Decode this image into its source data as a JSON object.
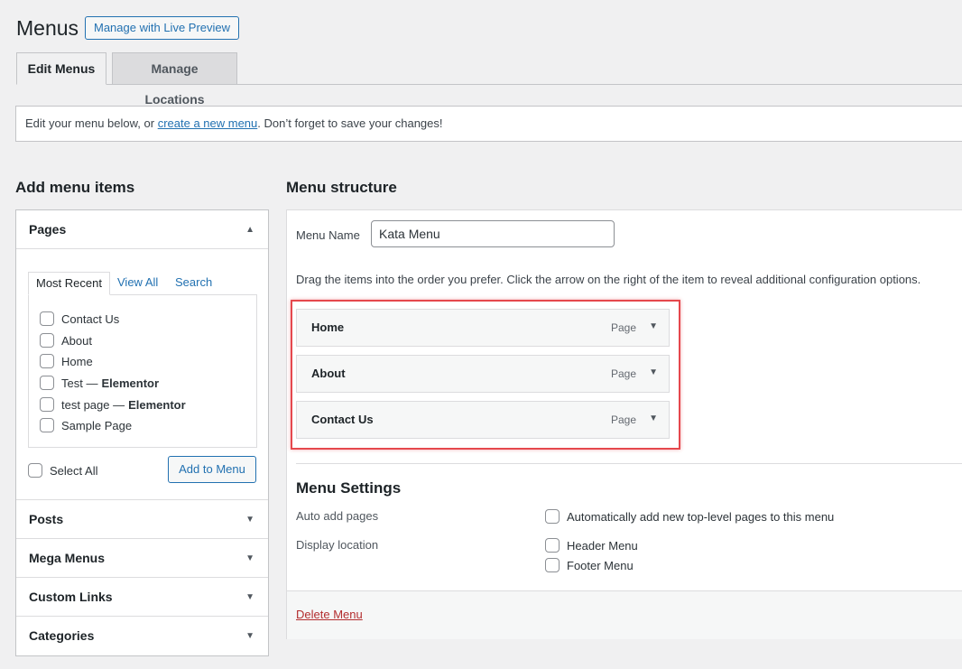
{
  "header": {
    "title": "Menus",
    "live_preview_label": "Manage with Live Preview"
  },
  "tabs": [
    {
      "label": "Edit Menus",
      "active": true
    },
    {
      "label": "Manage Locations",
      "active": false
    }
  ],
  "notice": {
    "prefix": "Edit your menu below, or ",
    "link": "create a new menu",
    "suffix": ". Don’t forget to save your changes!"
  },
  "left": {
    "heading": "Add menu items",
    "pages": {
      "title": "Pages",
      "subtabs": [
        "Most Recent",
        "View All",
        "Search"
      ],
      "items": [
        {
          "label": "Contact Us",
          "suffix": ""
        },
        {
          "label": "About",
          "suffix": ""
        },
        {
          "label": "Home",
          "suffix": ""
        },
        {
          "label": "Test —",
          "suffix": "Elementor"
        },
        {
          "label": "test page —",
          "suffix": "Elementor"
        },
        {
          "label": "Sample Page",
          "suffix": ""
        }
      ],
      "select_all": "Select All",
      "add_button": "Add to Menu"
    },
    "sections": [
      "Posts",
      "Mega Menus",
      "Custom Links",
      "Categories"
    ]
  },
  "right": {
    "heading": "Menu structure",
    "menu_name_label": "Menu Name",
    "menu_name_value": "Kata Menu",
    "instructions": "Drag the items into the order you prefer. Click the arrow on the right of the item to reveal additional configuration options.",
    "menu_items": [
      {
        "title": "Home",
        "type": "Page"
      },
      {
        "title": "About",
        "type": "Page"
      },
      {
        "title": "Contact Us",
        "type": "Page"
      }
    ],
    "settings": {
      "heading": "Menu Settings",
      "auto_add_label": "Auto add pages",
      "auto_add_option": "Automatically add new top-level pages to this menu",
      "display_label": "Display location",
      "display_options": [
        "Header Menu",
        "Footer Menu"
      ]
    },
    "delete_label": "Delete Menu"
  },
  "colors": {
    "accent": "#2271b1",
    "highlight": "#e5484d",
    "delete": "#b32d2e"
  }
}
